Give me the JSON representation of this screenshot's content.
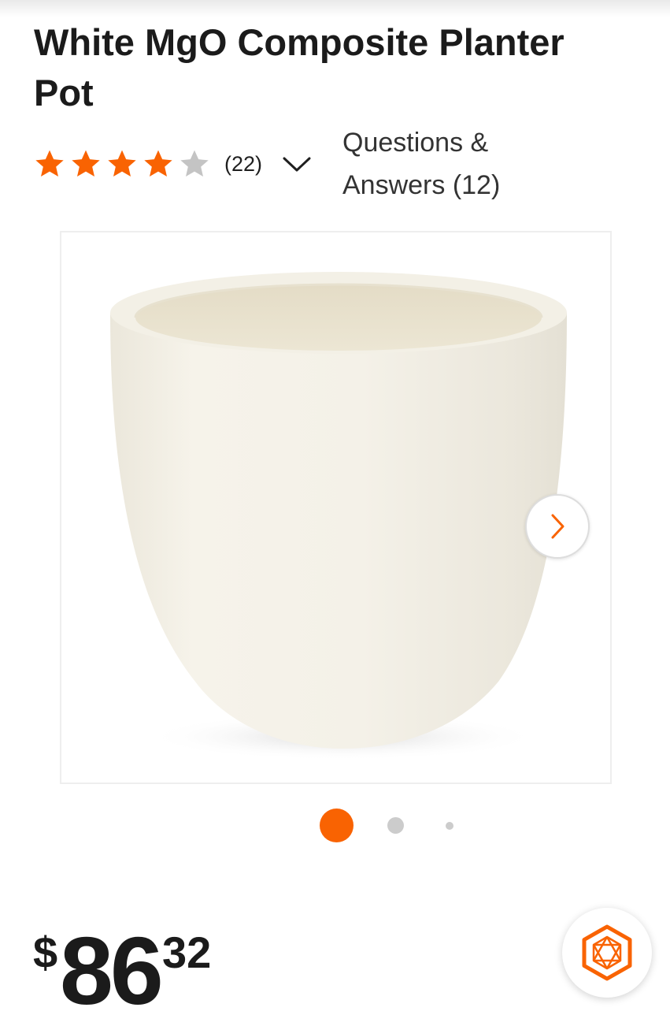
{
  "product": {
    "title": "White MgO Composite Planter Pot",
    "rating": {
      "value": 4,
      "max": 5,
      "review_count_text": "(22)"
    },
    "qa_text": "Questions & Answers (12)"
  },
  "gallery": {
    "image_count": 3,
    "active_index": 0,
    "next_icon": "chevron-right-icon"
  },
  "price": {
    "currency": "$",
    "dollars": "86",
    "cents": "32"
  },
  "assistant": {
    "icon": "hexagon-assistant-icon"
  },
  "colors": {
    "brand_orange": "#f96302",
    "star_empty": "#c4c4c4",
    "dot_inactive": "#cccccc"
  }
}
